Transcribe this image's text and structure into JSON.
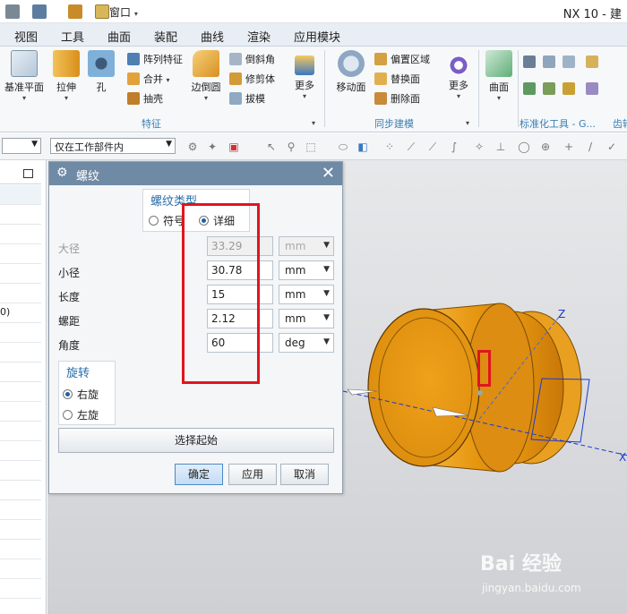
{
  "window": {
    "title": "NX 10 - 建",
    "menu_window": "窗口"
  },
  "menu": {
    "tabs": [
      "视图",
      "工具",
      "曲面",
      "装配",
      "曲线",
      "渲染",
      "应用模块"
    ]
  },
  "ribbon": {
    "feature": {
      "datum_plane": "基准平面",
      "extrude": "拉伸",
      "hole": "孔",
      "pattern_feature": "阵列特征",
      "unite": "合并",
      "shell": "抽壳",
      "edge_blend": "边倒圆",
      "chamfer": "倒斜角",
      "trim_body": "修剪体",
      "draft": "拔模",
      "more": "更多",
      "group_label": "特征"
    },
    "sync": {
      "move_face": "移动面",
      "offset_region": "偏置区域",
      "replace_face": "替换面",
      "delete_face": "删除面",
      "more": "更多",
      "group_label": "同步建模"
    },
    "surface": {
      "surface": "曲面"
    },
    "standard": {
      "group_label": "标准化工具 - G...",
      "group_label_2": "齿轮"
    }
  },
  "selection_bar": {
    "type_filter": "",
    "scope": "仅在工作部件内"
  },
  "dialog": {
    "title": "螺纹",
    "thread_type_label": "螺纹类型",
    "type_symbolic": "符号",
    "type_detailed": "详细",
    "fields": {
      "major_diameter": {
        "label": "大径",
        "value": "33.29",
        "unit": "mm"
      },
      "minor_diameter": {
        "label": "小径",
        "value": "30.78",
        "unit": "mm"
      },
      "length": {
        "label": "长度",
        "value": "15",
        "unit": "mm"
      },
      "pitch": {
        "label": "螺距",
        "value": "2.12",
        "unit": "mm"
      },
      "angle": {
        "label": "角度",
        "value": "60",
        "unit": "deg"
      }
    },
    "rotation_label": "旋转",
    "right_hand": "右旋",
    "left_hand": "左旋",
    "select_start": "选择起始",
    "ok": "确定",
    "apply": "应用",
    "cancel": "取消"
  },
  "viewport": {
    "axis_z": "Z",
    "axis_x": "X"
  },
  "left_panel": {
    "row_text": "0)"
  },
  "watermark": {
    "text": "Bai 经验",
    "url": "jingyan.baidu.com"
  },
  "colors": {
    "part": "#f0a11a",
    "highlight": "#e0151f",
    "dialog_title": "#6f8aa5",
    "accent": "#2a6ea8"
  }
}
